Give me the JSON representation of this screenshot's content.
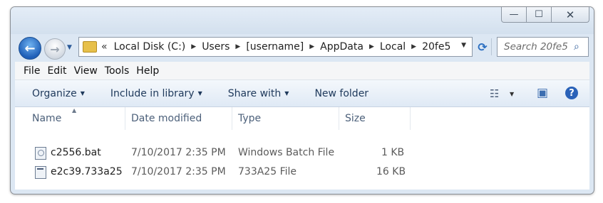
{
  "window": {
    "caption_buttons": {
      "minimize": "—",
      "maximize": "☐",
      "close": "✕"
    }
  },
  "nav": {
    "back_glyph": "←",
    "forward_glyph": "→",
    "dropdown_glyph": "▼",
    "address": {
      "overflow": "«",
      "crumbs": [
        "Local Disk (C:)",
        "Users",
        "[username]",
        "AppData",
        "Local",
        "20fe5"
      ],
      "separator": "▶",
      "dropdown_glyph": "▼"
    },
    "refresh_glyph": "⟳",
    "search": {
      "placeholder": "Search 20fe5",
      "icon": "search-icon",
      "glyph": "⌕"
    }
  },
  "menubar": {
    "items": [
      "File",
      "Edit",
      "View",
      "Tools",
      "Help"
    ]
  },
  "commandbar": {
    "organize": "Organize",
    "include_in_library": "Include in library",
    "share_with": "Share with",
    "new_folder": "New folder",
    "dropdown_glyph": "▼",
    "views_glyph": "☷",
    "preview_glyph": "▣",
    "help_glyph": "?"
  },
  "columns": {
    "name": "Name",
    "date_modified": "Date modified",
    "type": "Type",
    "size": "Size",
    "sort_glyph": "▲"
  },
  "files": [
    {
      "name": "c2556.bat",
      "date": "7/10/2017 2:35 PM",
      "type": "Windows Batch File",
      "size": "1 KB",
      "icon": "batch-file-icon"
    },
    {
      "name": "e2c39.733a25",
      "date": "7/10/2017 2:35 PM",
      "type": "733A25 File",
      "size": "16 KB",
      "icon": "generic-file-icon"
    }
  ],
  "colors": {
    "accent": "#1e395b",
    "window_frame": "#dce7f3",
    "help": "#2a62b8"
  }
}
